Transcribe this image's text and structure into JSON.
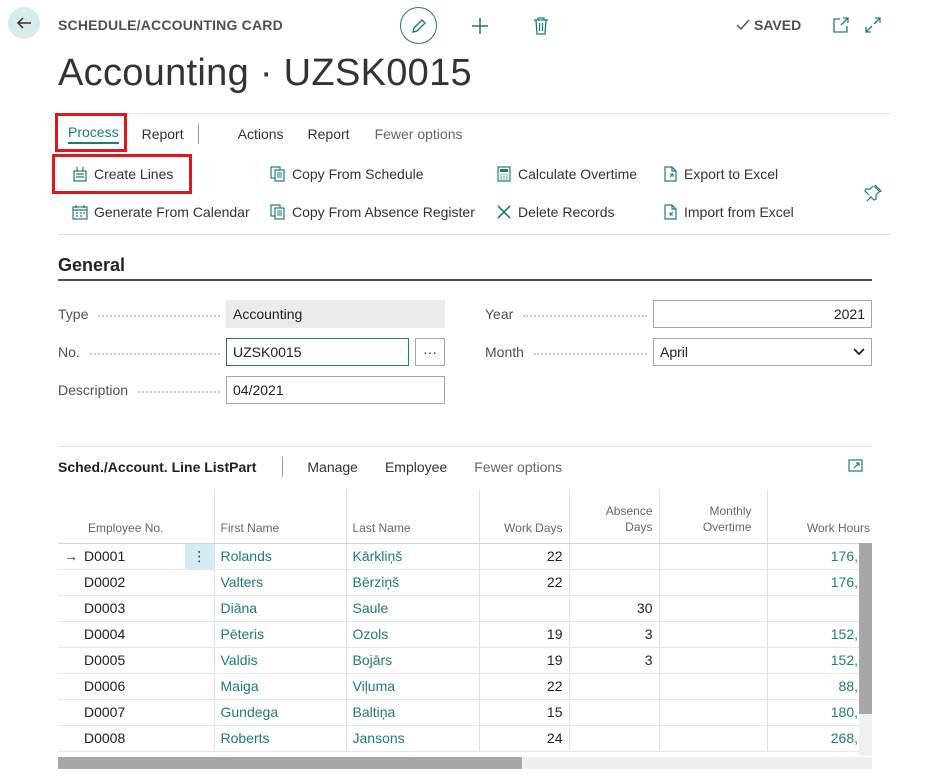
{
  "header": {
    "breadcrumb": "SCHEDULE/ACCOUNTING CARD",
    "saved_label": "SAVED",
    "page_title": "Accounting · UZSK0015"
  },
  "action_tabs": [
    "Process",
    "Report",
    "Actions",
    "Report",
    "Fewer options"
  ],
  "actions": {
    "create_lines": "Create Lines",
    "generate_from_calendar": "Generate From Calendar",
    "copy_from_schedule": "Copy From Schedule",
    "copy_from_absence_register": "Copy From Absence Register",
    "calculate_overtime": "Calculate Overtime",
    "delete_records": "Delete Records",
    "export_to_excel": "Export to Excel",
    "import_from_excel": "Import from Excel"
  },
  "general": {
    "section_title": "General",
    "type_label": "Type",
    "type_value": "Accounting",
    "no_label": "No.",
    "no_value": "UZSK0015",
    "description_label": "Description",
    "description_value": "04/2021",
    "year_label": "Year",
    "year_value": "2021",
    "month_label": "Month",
    "month_value": "April"
  },
  "listpart": {
    "title": "Sched./Account. Line ListPart",
    "menu": [
      "Manage",
      "Employee",
      "Fewer options"
    ],
    "columns": {
      "employee_no": "Employee No.",
      "first_name": "First Name",
      "last_name": "Last Name",
      "work_days": "Work Days",
      "absence_days_1": "Absence",
      "absence_days_2": "Days",
      "monthly_overtime_1": "Monthly",
      "monthly_overtime_2": "Overtime",
      "work_hours": "Work Hours"
    },
    "rows": [
      {
        "employee_no": "D0001",
        "first_name": "Rolands",
        "last_name": "Kārkliņš",
        "work_days": "22",
        "absence_days": "",
        "monthly_overtime": "",
        "work_hours": "176,"
      },
      {
        "employee_no": "D0002",
        "first_name": "Valters",
        "last_name": "Bērziņš",
        "work_days": "22",
        "absence_days": "",
        "monthly_overtime": "",
        "work_hours": "176,"
      },
      {
        "employee_no": "D0003",
        "first_name": "Diāna",
        "last_name": "Saule",
        "work_days": "",
        "absence_days": "30",
        "monthly_overtime": "",
        "work_hours": ""
      },
      {
        "employee_no": "D0004",
        "first_name": "Pēteris",
        "last_name": "Ozols",
        "work_days": "19",
        "absence_days": "3",
        "monthly_overtime": "",
        "work_hours": "152,"
      },
      {
        "employee_no": "D0005",
        "first_name": "Valdis",
        "last_name": "Bojārs",
        "work_days": "19",
        "absence_days": "3",
        "monthly_overtime": "",
        "work_hours": "152,"
      },
      {
        "employee_no": "D0006",
        "first_name": "Maiga",
        "last_name": "Viļuma",
        "work_days": "22",
        "absence_days": "",
        "monthly_overtime": "",
        "work_hours": "88,"
      },
      {
        "employee_no": "D0007",
        "first_name": "Gundega",
        "last_name": "Baltiņa",
        "work_days": "15",
        "absence_days": "",
        "monthly_overtime": "",
        "work_hours": "180,"
      },
      {
        "employee_no": "D0008",
        "first_name": "Roberts",
        "last_name": "Jansons",
        "work_days": "24",
        "absence_days": "",
        "monthly_overtime": "",
        "work_hours": "268,"
      }
    ]
  },
  "colors": {
    "accent": "#1c7b7d",
    "highlight_box": "#e0161b",
    "selected_cell": "#d3edf2"
  }
}
